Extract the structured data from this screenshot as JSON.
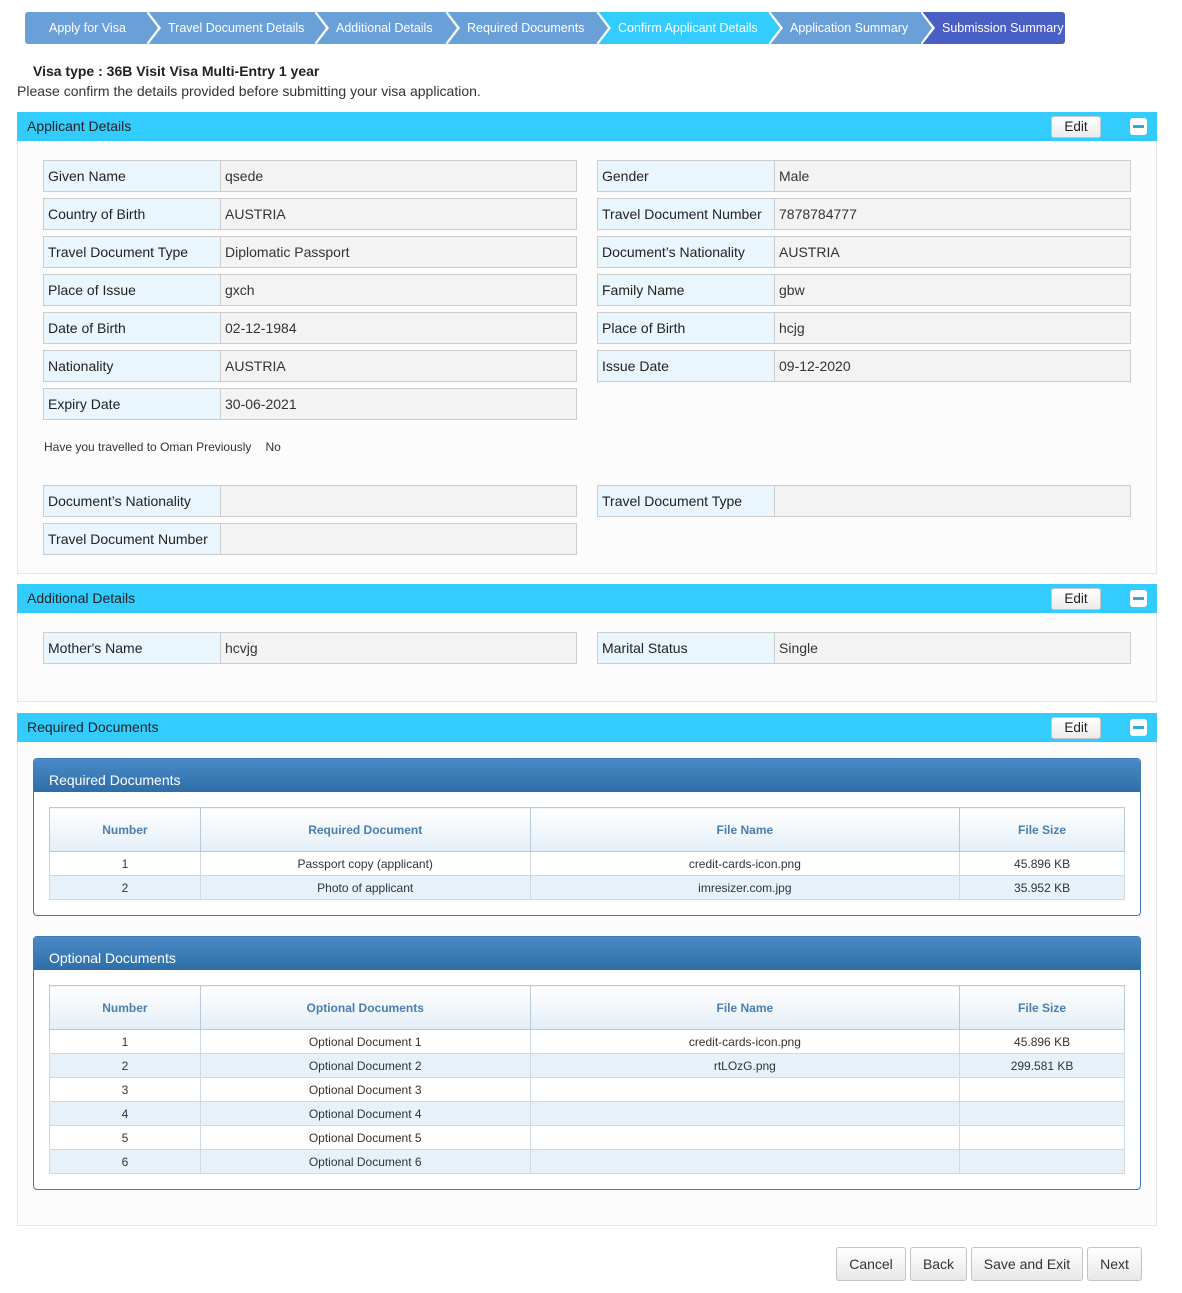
{
  "wizard": {
    "steps": [
      {
        "label": "Apply for Visa",
        "color": "#6aa0d8"
      },
      {
        "label": "Travel Document Details",
        "color": "#6aa0d8"
      },
      {
        "label": "Additional Details",
        "color": "#6aa0d8"
      },
      {
        "label": "Required Documents",
        "color": "#6aa0d8"
      },
      {
        "label": "Confirm Applicant Details",
        "color": "#33ccff"
      },
      {
        "label": "Application Summary",
        "color": "#6aa0d8"
      },
      {
        "label": "Submission Summary",
        "color": "#4a5fc4"
      }
    ]
  },
  "header": {
    "visa_type": "Visa type  : 36B Visit Visa Multi-Entry 1 year",
    "confirm_text": "Please confirm the details provided before submitting your visa application."
  },
  "applicant": {
    "title": "Applicant Details",
    "edit_label": "Edit",
    "left": [
      {
        "label": "Given Name",
        "value": "qsede"
      },
      {
        "label": "Country of Birth",
        "value": "AUSTRIA"
      },
      {
        "label": "Travel Document Type",
        "value": "Diplomatic Passport"
      },
      {
        "label": "Place of Issue",
        "value": "gxch"
      },
      {
        "label": "Date of Birth",
        "value": "02-12-1984"
      },
      {
        "label": "Nationality",
        "value": "AUSTRIA"
      },
      {
        "label": "Expiry Date",
        "value": "30-06-2021"
      }
    ],
    "right": [
      {
        "label": "Gender",
        "value": "Male"
      },
      {
        "label": "Travel Document Number",
        "value": "7878784777"
      },
      {
        "label": "Document’s Nationality",
        "value": "AUSTRIA"
      },
      {
        "label": "Family Name",
        "value": "gbw"
      },
      {
        "label": "Place of Birth",
        "value": "hcjg"
      },
      {
        "label": "Issue Date",
        "value": "09-12-2020"
      }
    ],
    "travelled_question": "Have you travelled to Oman Previously",
    "travelled_answer": "No",
    "prev": [
      {
        "label": "Document’s Nationality",
        "value": ""
      },
      {
        "label": "Travel Document Type",
        "value": ""
      },
      {
        "label": "Travel Document Number",
        "value": ""
      }
    ]
  },
  "additional": {
    "title": "Additional Details",
    "edit_label": "Edit",
    "fields": [
      {
        "label": "Mother's Name",
        "value": "hcvjg"
      },
      {
        "label": "Marital Status",
        "value": "Single"
      }
    ]
  },
  "required_section": {
    "title": "Required Documents",
    "edit_label": "Edit"
  },
  "required_docs": {
    "title": "Required Documents",
    "columns": [
      "Number",
      "Required Document",
      "File Name",
      "File Size"
    ],
    "rows": [
      [
        "1",
        "Passport copy (applicant)",
        "credit-cards-icon.png",
        "45.896 KB"
      ],
      [
        "2",
        "Photo of applicant",
        "imresizer.com.jpg",
        "35.952 KB"
      ]
    ]
  },
  "optional_docs": {
    "title": "Optional Documents",
    "columns": [
      "Number",
      "Optional Documents",
      "File Name",
      "File Size"
    ],
    "rows": [
      [
        "1",
        "Optional Document 1",
        "credit-cards-icon.png",
        "45.896 KB"
      ],
      [
        "2",
        "Optional Document 2",
        "rtLOzG.png",
        "299.581 KB"
      ],
      [
        "3",
        "Optional Document 3",
        "",
        ""
      ],
      [
        "4",
        "Optional Document 4",
        "",
        ""
      ],
      [
        "5",
        "Optional Document 5",
        "",
        ""
      ],
      [
        "6",
        "Optional Document 6",
        "",
        ""
      ]
    ]
  },
  "footer": {
    "cancel": "Cancel",
    "back": "Back",
    "save_exit": "Save and Exit",
    "next": "Next"
  }
}
